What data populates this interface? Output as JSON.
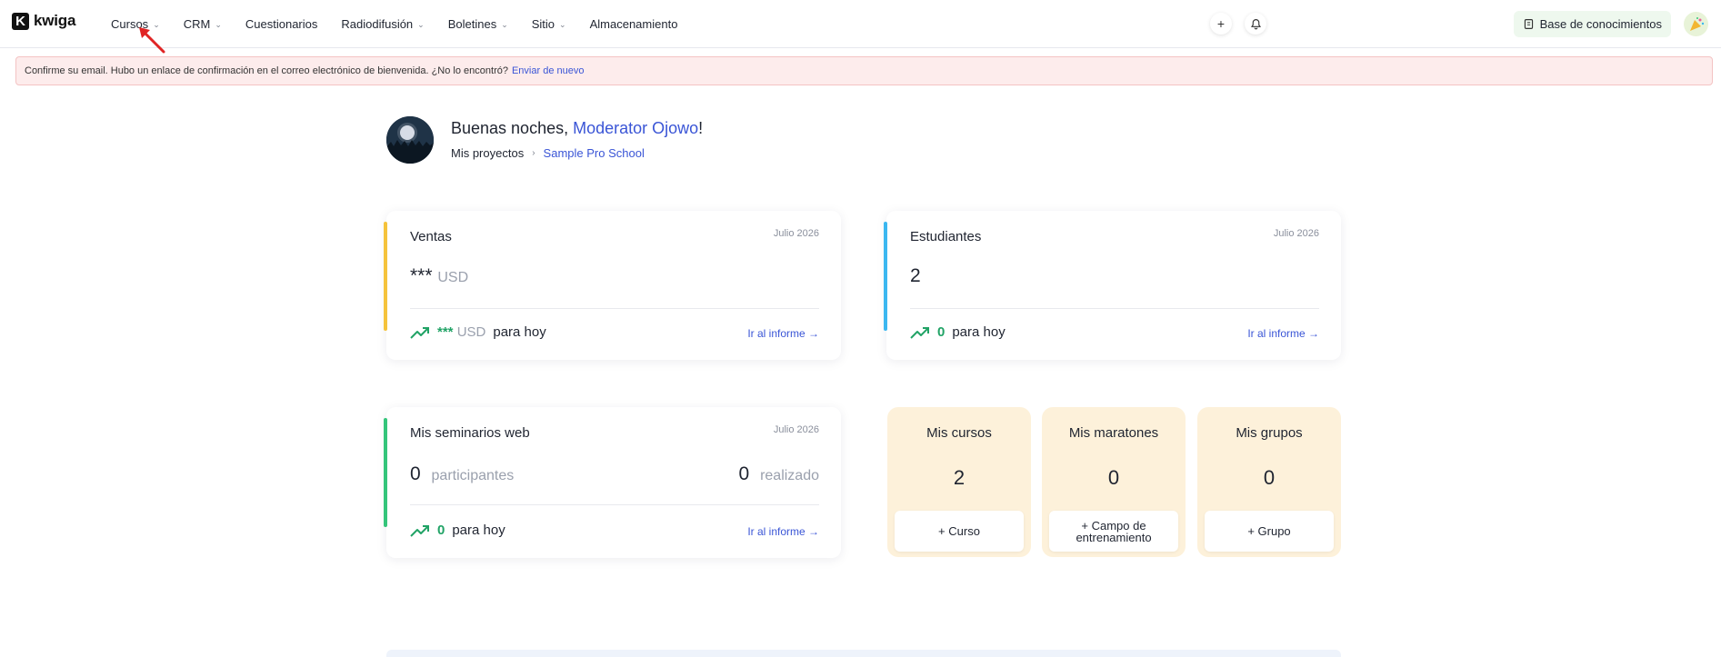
{
  "brand": {
    "logo_letter": "K",
    "name": "kwiga"
  },
  "nav": [
    {
      "label": "Cursos",
      "dropdown": true
    },
    {
      "label": "CRM",
      "dropdown": true
    },
    {
      "label": "Cuestionarios",
      "dropdown": false
    },
    {
      "label": "Radiodifusión",
      "dropdown": true
    },
    {
      "label": "Boletines",
      "dropdown": true
    },
    {
      "label": "Sitio",
      "dropdown": true
    },
    {
      "label": "Almacenamiento",
      "dropdown": false
    }
  ],
  "topbar": {
    "plus": "+",
    "knowledge_base_label": "Base de conocimientos"
  },
  "alert": {
    "text": "Confirme su email. Hubo un enlace de confirmación en el correo electrónico de bienvenida. ¿No lo encontró?",
    "link": "Enviar de nuevo"
  },
  "greeting": {
    "prefix": "Buenas noches, ",
    "name": "Moderator Ojowo",
    "suffix": "!",
    "crumb_root": "Mis proyectos",
    "crumb_sep": "›",
    "crumb_current": "Sample Pro School"
  },
  "sales": {
    "title": "Ventas",
    "date": "Julio 2026",
    "value": "***",
    "currency": "USD",
    "today_value": "***",
    "today_currency": "USD",
    "today_label": "para hoy",
    "report_link": "Ir al informe →",
    "accent": "#f5c33b"
  },
  "students": {
    "title": "Estudiantes",
    "date": "Julio 2026",
    "value": "2",
    "today_value": "0",
    "today_label": "para hoy",
    "report_link": "Ir al informe →",
    "accent": "#3bb7f0"
  },
  "webinars": {
    "title": "Mis seminarios web",
    "date": "Julio 2026",
    "participants_value": "0",
    "participants_label": "participantes",
    "done_value": "0",
    "done_label": "realizado",
    "today_value": "0",
    "today_label": "para hoy",
    "report_link": "Ir al informe →",
    "accent": "#34c57a"
  },
  "mini_cards": [
    {
      "title": "Mis cursos",
      "value": "2",
      "button": "+ Curso"
    },
    {
      "title": "Mis maratones",
      "value": "0",
      "button": "+ Campo de entrenamiento"
    },
    {
      "title": "Mis grupos",
      "value": "0",
      "button": "+ Grupo"
    }
  ],
  "icons": {
    "trend": "trending-up-icon",
    "bell": "bell-icon",
    "book": "knowledge-base-icon",
    "chevron": "chevron-down-icon"
  }
}
